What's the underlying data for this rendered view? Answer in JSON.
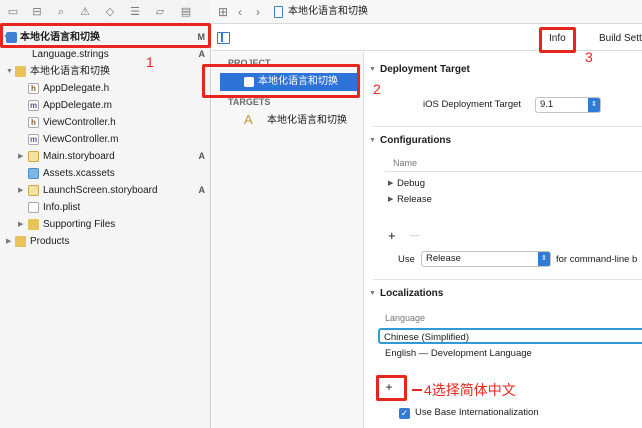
{
  "navigator": {
    "items": [
      {
        "label": "本地化语言和切换",
        "badge": "M",
        "icon": "project-icon"
      },
      {
        "label": "Language.strings",
        "badge": "A",
        "icon": "strings-file-icon"
      },
      {
        "label": "本地化语言和切换",
        "badge": "",
        "icon": "folder-icon"
      },
      {
        "label": "AppDelegate.h",
        "badge": "",
        "icon": "header-file-icon"
      },
      {
        "label": "AppDelegate.m",
        "badge": "",
        "icon": "implementation-file-icon"
      },
      {
        "label": "ViewController.h",
        "badge": "",
        "icon": "header-file-icon"
      },
      {
        "label": "ViewController.m",
        "badge": "",
        "icon": "implementation-file-icon"
      },
      {
        "label": "Main.storyboard",
        "badge": "A",
        "icon": "storyboard-icon"
      },
      {
        "label": "Assets.xcassets",
        "badge": "",
        "icon": "assets-icon"
      },
      {
        "label": "LaunchScreen.storyboard",
        "badge": "A",
        "icon": "storyboard-icon"
      },
      {
        "label": "Info.plist",
        "badge": "",
        "icon": "plist-icon"
      },
      {
        "label": "Supporting Files",
        "badge": "",
        "icon": "folder-icon"
      },
      {
        "label": "Products",
        "badge": "",
        "icon": "folder-icon"
      }
    ],
    "file_type_letters": {
      "h": "h",
      "m": "m"
    }
  },
  "editor_bar": {
    "breadcrumb": "本地化语言和切换"
  },
  "tabs": {
    "info": "Info",
    "build_settings": "Build Sett"
  },
  "project_list": {
    "project_header": "PROJECT",
    "project_item": "本地化语言和切换",
    "targets_header": "TARGETS",
    "target_item": "本地化语言和切换"
  },
  "deployment": {
    "title": "Deployment Target",
    "ios_label": "iOS Deployment Target",
    "ios_value": "9.1"
  },
  "configurations": {
    "title": "Configurations",
    "name_header": "Name",
    "rows": [
      "Debug",
      "Release"
    ],
    "add_symbol": "+",
    "remove_symbol": "—",
    "use_label": "Use",
    "use_value": "Release",
    "use_suffix": "for command-line b"
  },
  "localizations": {
    "title": "Localizations",
    "language_header": "Language",
    "rows": [
      "Chinese (Simplified)",
      "English — Development Language"
    ],
    "add_symbol": "+",
    "base_label": "Use Base Internationalization",
    "base_checked": true
  },
  "annotations": {
    "n1": "1",
    "n2": "2",
    "n3": "3",
    "n4_text": "4选择简体中文"
  },
  "colors": {
    "annotation": "#e8261f",
    "selection": "#2e73d7",
    "accent": "#2f7bd6"
  }
}
